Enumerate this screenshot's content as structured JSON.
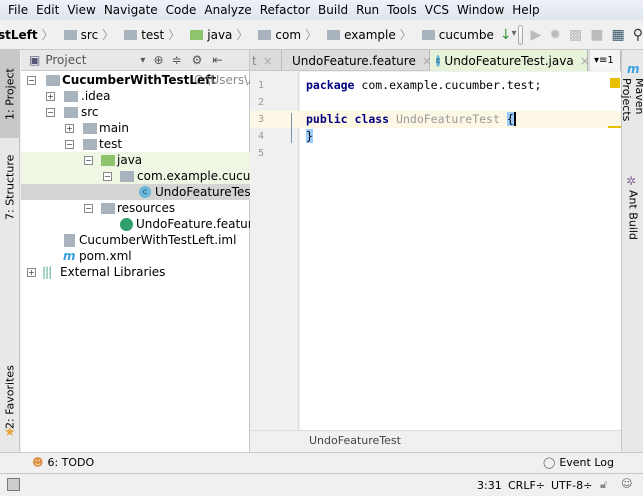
{
  "menu": [
    "File",
    "Edit",
    "View",
    "Navigate",
    "Code",
    "Analyze",
    "Refactor",
    "Build",
    "Run",
    "Tools",
    "VCS",
    "Window",
    "Help"
  ],
  "breadcrumbs": [
    "stLeft",
    "src",
    "test",
    "java",
    "com",
    "example",
    "cucumbe"
  ],
  "left_tabs": {
    "project": "1: Project",
    "structure": "7: Structure",
    "favorites": "2: Favorites"
  },
  "right_tabs": {
    "maven": "Maven Projects",
    "ant": "Ant Build"
  },
  "project_panel": {
    "title": "Project"
  },
  "tree": [
    {
      "label": "CucumberWithTestLeft",
      "path": "C:\\Users\\Al"
    },
    {
      "label": ".idea"
    },
    {
      "label": "src"
    },
    {
      "label": "main"
    },
    {
      "label": "test"
    },
    {
      "label": "java"
    },
    {
      "label": "com.example.cucumber"
    },
    {
      "label": "UndoFeatureTest"
    },
    {
      "label": "resources"
    },
    {
      "label": "UndoFeature.feature"
    },
    {
      "label": "CucumberWithTestLeft.iml"
    },
    {
      "label": "pom.xml"
    },
    {
      "label": "External Libraries"
    }
  ],
  "tabs": [
    {
      "label": "t"
    },
    {
      "label": "UndoFeature.feature"
    },
    {
      "label": "UndoFeatureTest.java"
    }
  ],
  "tab_overflow": "1",
  "code": {
    "line_numbers": [
      "1",
      "2",
      "3",
      "4",
      "5"
    ],
    "l1_kw": "package",
    "l1_rest": " com.example.cucumber.test;",
    "l3_kw1": "public",
    "l3_kw2": "class",
    "l3_cls": "UndoFeatureTest",
    "l3_brace": "{",
    "l4_brace": "}"
  },
  "editor_breadcrumb": "UndoFeatureTest",
  "bottom": {
    "todo": "6: TODO",
    "event_log": "Event Log"
  },
  "status": {
    "position": "3:31",
    "line_sep": "CRLF÷",
    "encoding": "UTF-8÷"
  }
}
